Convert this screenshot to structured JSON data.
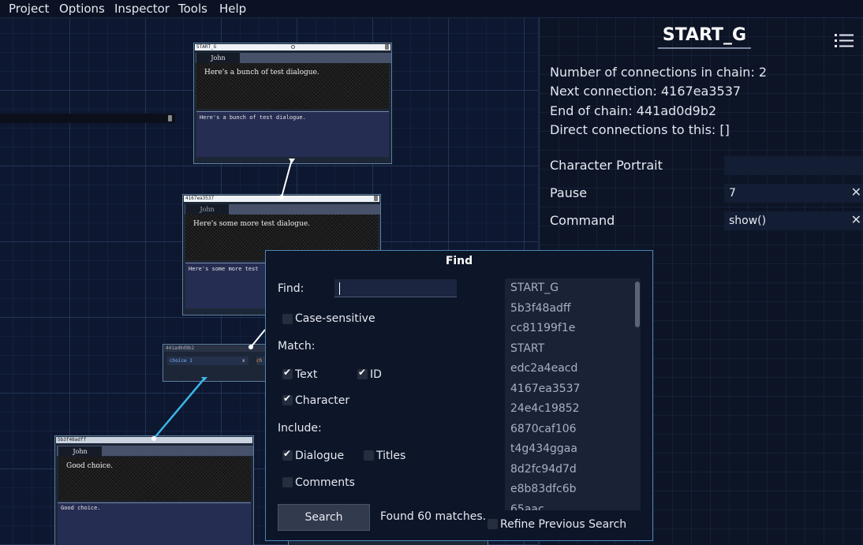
{
  "menu": [
    "Project",
    "Options",
    "Inspector",
    "Tools",
    "Help"
  ],
  "nodes": {
    "n1": {
      "id": "START_G",
      "character": "John",
      "text": "Here's a bunch of test dialogue.",
      "edit": "Here's a bunch of test dialogue."
    },
    "n2": {
      "id": "4167ea3537",
      "character": "John",
      "text": "Here's some more test dialogue.",
      "edit": "Here's some more test"
    },
    "n3": {
      "id": "441ad0d9b2",
      "choice": "choice 1",
      "choice2": "ch"
    },
    "n4": {
      "id": "5b3f48adff",
      "character": "John",
      "text": "Good choice.",
      "edit": "Good choice."
    }
  },
  "inspector": {
    "title": "START_G",
    "connections": "Number of connections in chain: 2",
    "next": "Next connection: 4167ea3537",
    "end": "End of chain: 441ad0d9b2",
    "direct": "Direct connections to this: []",
    "fields": [
      {
        "label": "Character Portrait",
        "value": ""
      },
      {
        "label": "Pause",
        "value": "7"
      },
      {
        "label": "Command",
        "value": "show()"
      }
    ]
  },
  "find": {
    "title": "Find",
    "find_label": "Find:",
    "find_value": "",
    "case_sensitive": "Case-sensitive",
    "match_label": "Match:",
    "match_text": "Text",
    "match_id": "ID",
    "match_character": "Character",
    "include_label": "Include:",
    "include_dialogue": "Dialogue",
    "include_titles": "Titles",
    "include_comments": "Comments",
    "search_button": "Search",
    "status": "Found 60 matches.",
    "refine": "Refine Previous Search",
    "results": [
      "START_G",
      "5b3f48adff",
      "cc81199f1e",
      "START",
      "edc2a4eacd",
      "4167ea3537",
      "24e4c19852",
      "6870caf106",
      "t4g434ggaa",
      "8d2fc94d7d",
      "e8b83dfc6b",
      "65aac..."
    ]
  }
}
